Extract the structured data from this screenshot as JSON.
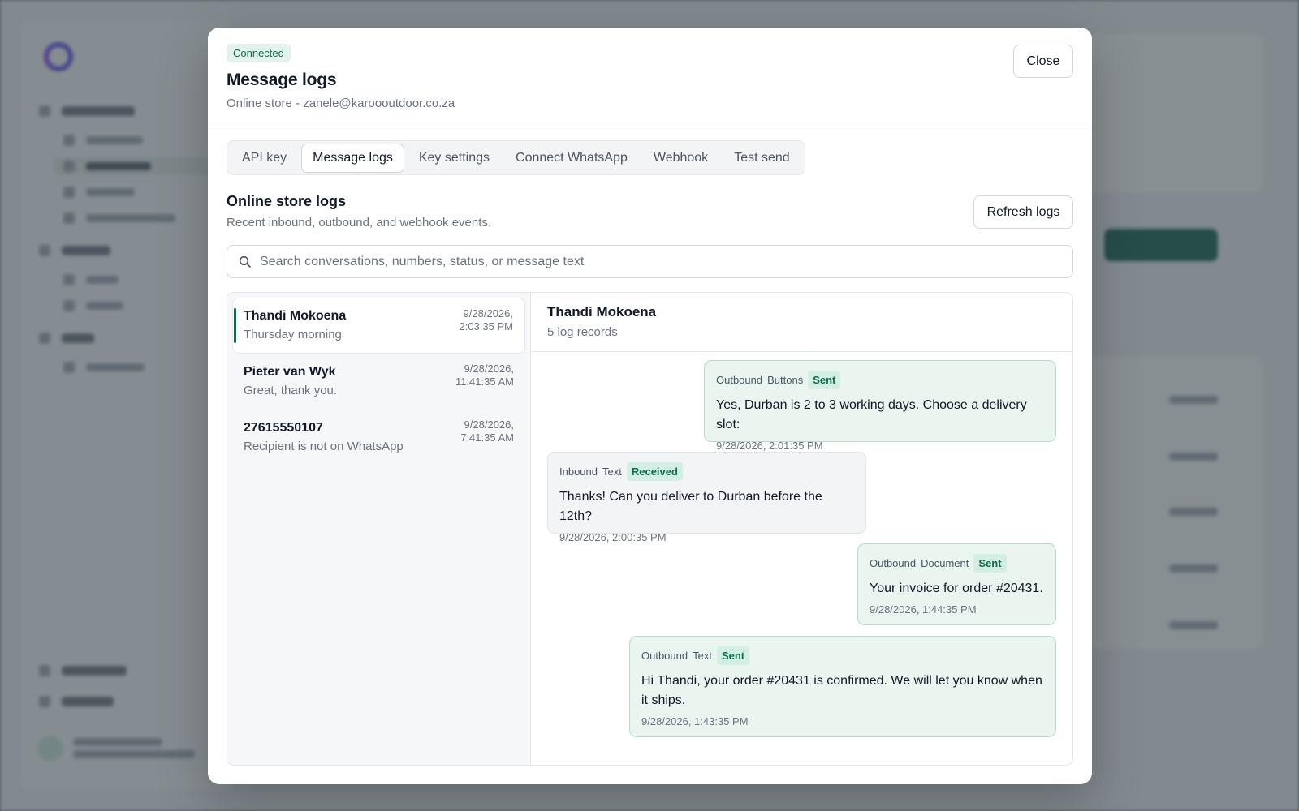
{
  "modal": {
    "status_badge": "Connected",
    "title": "Message logs",
    "subtitle": "Online store - zanele@karoooutdoor.co.za",
    "close_label": "Close"
  },
  "tabs": [
    {
      "label": "API key",
      "active": false
    },
    {
      "label": "Message logs",
      "active": true
    },
    {
      "label": "Key settings",
      "active": false
    },
    {
      "label": "Connect WhatsApp",
      "active": false
    },
    {
      "label": "Webhook",
      "active": false
    },
    {
      "label": "Test send",
      "active": false
    }
  ],
  "section": {
    "title": "Online store logs",
    "subtitle": "Recent inbound, outbound, and webhook events.",
    "refresh_label": "Refresh logs"
  },
  "search": {
    "placeholder": "Search conversations, numbers, status, or message text",
    "value": ""
  },
  "conversations": [
    {
      "name": "Thandi Mokoena",
      "preview": "Thursday morning",
      "date": "9/28/2026,",
      "time": "2:03:35 PM",
      "active": true
    },
    {
      "name": "Pieter van Wyk",
      "preview": "Great, thank you.",
      "date": "9/28/2026,",
      "time": "11:41:35 AM",
      "active": false
    },
    {
      "name": "27615550107",
      "preview": "Recipient is not on WhatsApp",
      "date": "9/28/2026,",
      "time": "7:41:35 AM",
      "active": false
    }
  ],
  "chat": {
    "name": "Thandi Mokoena",
    "count": "5 log records",
    "messages": [
      {
        "direction": "Outbound",
        "type": "Buttons",
        "status": "Sent",
        "text": "Yes, Durban is 2 to 3 working days. Choose a delivery slot:",
        "timestamp": "9/28/2026, 2:01:35 PM"
      },
      {
        "direction": "Inbound",
        "type": "Text",
        "status": "Received",
        "text": "Thanks! Can you deliver to Durban before the 12th?",
        "timestamp": "9/28/2026, 2:00:35 PM"
      },
      {
        "direction": "Outbound",
        "type": "Document",
        "status": "Sent",
        "text": "Your invoice for order #20431.",
        "timestamp": "9/28/2026, 1:44:35 PM"
      },
      {
        "direction": "Outbound",
        "type": "Text",
        "status": "Sent",
        "text": "Hi Thandi, your order #20431 is confirmed. We will let you know when it ships.",
        "timestamp": "9/28/2026, 1:43:35 PM"
      }
    ]
  },
  "colors": {
    "accent": "#0f6b4f",
    "outbound_bubble": "#eaf5f0",
    "inbound_bubble": "#f3f4f6",
    "overlay": "#6b7378"
  }
}
